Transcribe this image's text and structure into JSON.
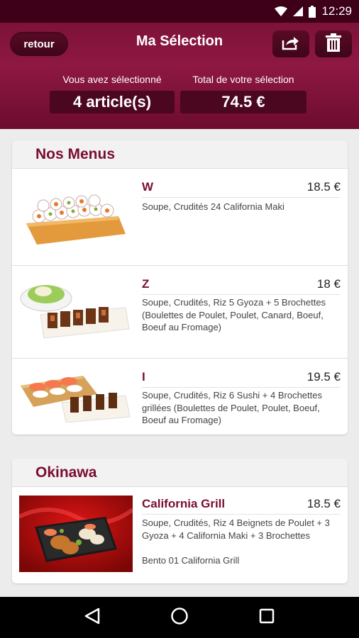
{
  "status_bar": {
    "time": "12:29",
    "icons": [
      "wifi-icon",
      "cell-signal-icon",
      "battery-icon"
    ]
  },
  "header": {
    "back_label": "retour",
    "title": "Ma Sélection",
    "share_icon": "share-icon",
    "trash_icon": "trash-icon"
  },
  "summary": {
    "count_label": "Vous avez sélectionné",
    "count_value": "4 article(s)",
    "total_label": "Total de votre sélection",
    "total_value": "74.5 €"
  },
  "sections": [
    {
      "title": "Nos Menus",
      "items": [
        {
          "name": "W",
          "price": "18.5 €",
          "desc": "Soupe, Crudités 24 California Maki"
        },
        {
          "name": "Z",
          "price": "18 €",
          "desc": "Soupe, Crudités, Riz 5 Gyoza + 5 Brochettes (Boulettes de Poulet, Poulet, Canard, Boeuf, Boeuf au Fromage)"
        },
        {
          "name": "I",
          "price": "19.5 €",
          "desc": "Soupe, Crudités, Riz 6 Sushi + 4 Brochettes grillées (Boulettes de Poulet, Poulet, Boeuf, Boeuf au Fromage)"
        }
      ]
    },
    {
      "title": "Okinawa",
      "items": [
        {
          "name": "California Grill",
          "price": "18.5 €",
          "desc": "Soupe, Crudités, Riz 4 Beignets de Poulet + 3 Gyoza + 4 California Maki + 3 Brochettes",
          "desc2": "Bento 01 California Grill"
        }
      ]
    }
  ],
  "nav": {
    "back": "back-icon",
    "home": "home-icon",
    "recents": "recents-icon"
  },
  "colors": {
    "brand": "#7a0d33",
    "header": "#8e1843",
    "status_bar": "#3d0018"
  }
}
